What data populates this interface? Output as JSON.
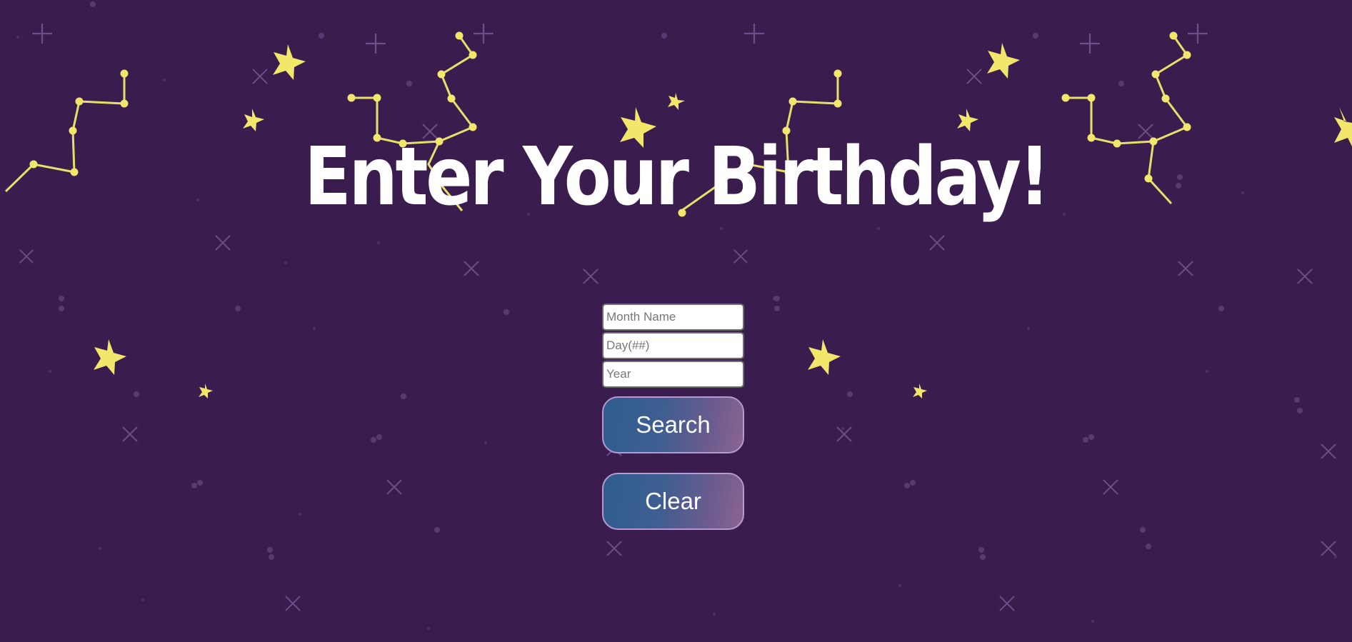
{
  "page": {
    "title": "Enter Your Birthday!"
  },
  "form": {
    "month": {
      "placeholder": "Month Name",
      "value": ""
    },
    "day": {
      "placeholder": "Day(##)",
      "value": ""
    },
    "year": {
      "placeholder": "Year",
      "value": ""
    },
    "search_label": "Search",
    "clear_label": "Clear"
  },
  "theme": {
    "background": "#3a1d4e",
    "star": "#f3e76b",
    "title_color": "#ffffff",
    "button_gradient_start": "#2f5d8e",
    "button_gradient_end": "#8a6493"
  }
}
